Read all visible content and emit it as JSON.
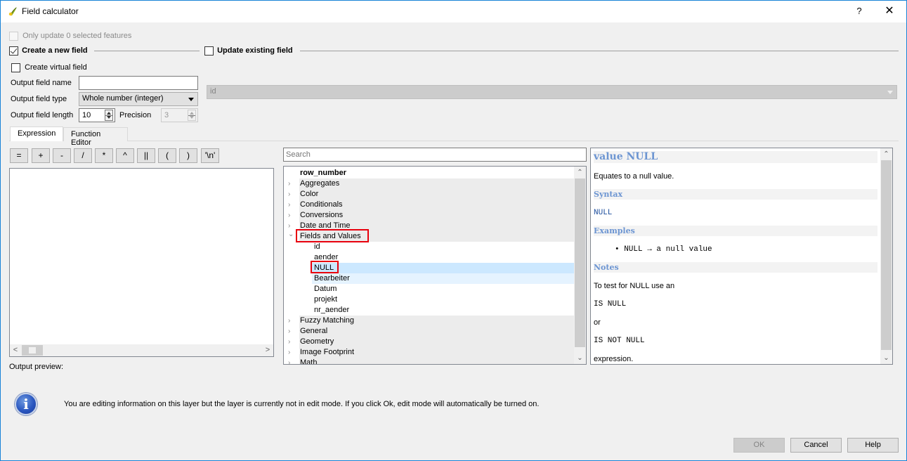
{
  "window": {
    "title": "Field calculator",
    "help_label": "?",
    "close_label": "✕"
  },
  "options": {
    "only_update_selected": {
      "label": "Only update 0 selected features",
      "checked": false,
      "enabled": false
    },
    "create_new_field": {
      "label": "Create a new field",
      "checked": true
    },
    "update_existing_field": {
      "label": "Update existing field",
      "checked": false
    },
    "create_virtual_field": {
      "label": "Create virtual field",
      "checked": false
    }
  },
  "new_field": {
    "name_label": "Output field name",
    "name_value": "",
    "type_label": "Output field type",
    "type_value": "Whole number (integer)",
    "length_label": "Output field length",
    "length_value": "10",
    "precision_label": "Precision",
    "precision_value": "3"
  },
  "existing_field": {
    "selected": "id"
  },
  "tabs": [
    {
      "label": "Expression",
      "active": true
    },
    {
      "label": "Function Editor",
      "active": false
    }
  ],
  "operators": [
    "=",
    "+",
    "-",
    "/",
    "*",
    "^",
    "||",
    "(",
    ")",
    "'\\n'"
  ],
  "expression": {
    "value": "",
    "output_preview_label": "Output preview:"
  },
  "function_tree": {
    "search_placeholder": "Search",
    "items": [
      {
        "label": "row_number",
        "type": "recent",
        "bold": true
      },
      {
        "label": "Aggregates",
        "type": "group",
        "expanded": false
      },
      {
        "label": "Color",
        "type": "group",
        "expanded": false
      },
      {
        "label": "Conditionals",
        "type": "group",
        "expanded": false
      },
      {
        "label": "Conversions",
        "type": "group",
        "expanded": false
      },
      {
        "label": "Date and Time",
        "type": "group",
        "expanded": false
      },
      {
        "label": "Fields and Values",
        "type": "group",
        "expanded": true,
        "highlighted": true
      },
      {
        "label": "id",
        "type": "child"
      },
      {
        "label": "aender",
        "type": "child"
      },
      {
        "label": "NULL",
        "type": "child",
        "selected": true,
        "highlighted": true
      },
      {
        "label": "Bearbeiter",
        "type": "child",
        "hover": true
      },
      {
        "label": "Datum",
        "type": "child"
      },
      {
        "label": "projekt",
        "type": "child"
      },
      {
        "label": "nr_aender",
        "type": "child"
      },
      {
        "label": "Fuzzy Matching",
        "type": "group",
        "expanded": false
      },
      {
        "label": "General",
        "type": "group",
        "expanded": false
      },
      {
        "label": "Geometry",
        "type": "group",
        "expanded": false
      },
      {
        "label": "Image Footprint",
        "type": "group",
        "expanded": false
      },
      {
        "label": "Math",
        "type": "group",
        "expanded": false
      }
    ]
  },
  "help_panel": {
    "title": "value NULL",
    "description": "Equates to a null value.",
    "syntax_heading": "Syntax",
    "syntax": "NULL",
    "examples_heading": "Examples",
    "example": "NULL → a null value",
    "notes_heading": "Notes",
    "notes_line1": "To test for NULL use an",
    "notes_code1": "IS NULL",
    "notes_or": "or",
    "notes_code2": "IS NOT NULL",
    "notes_end": "expression."
  },
  "info_message": "You are editing information on this layer but the layer is currently not in edit mode. If you click Ok, edit mode will automatically be turned on.",
  "buttons": {
    "ok": {
      "label": "OK",
      "enabled": false
    },
    "cancel": {
      "label": "Cancel"
    },
    "help": {
      "label": "Help"
    }
  },
  "colors": {
    "window_border": "#1883d7",
    "highlight_box": "#e8000d",
    "selection": "#cce8ff",
    "hover": "#e5f3ff",
    "help_heading": "#6c95d2"
  }
}
